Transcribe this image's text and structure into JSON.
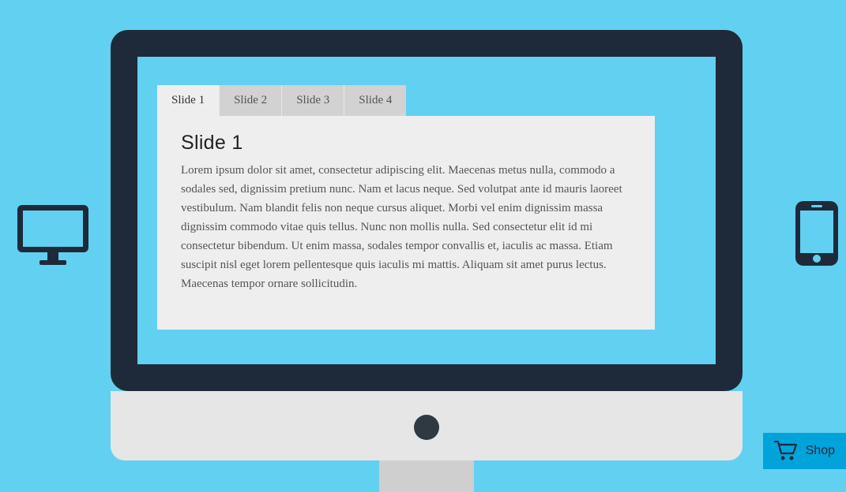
{
  "tabs": [
    {
      "label": "Slide 1",
      "active": true
    },
    {
      "label": "Slide 2",
      "active": false
    },
    {
      "label": "Slide 3",
      "active": false
    },
    {
      "label": "Slide 4",
      "active": false
    }
  ],
  "panel": {
    "title": "Slide 1",
    "body": "Lorem ipsum dolor sit amet, consectetur adipiscing elit. Maecenas metus nulla, commodo a sodales sed, dignissim pretium nunc. Nam et lacus neque. Sed volutpat ante id mauris laoreet vestibulum. Nam blandit felis non neque cursus aliquet. Morbi vel enim dignissim massa dignissim commodo vitae quis tellus. Nunc non mollis nulla. Sed consectetur elit id mi consectetur bibendum. Ut enim massa, sodales tempor convallis et, iaculis ac massa. Etiam suscipit nisl eget lorem pellentesque quis iaculis mi mattis. Aliquam sit amet purus lectus. Maecenas tempor ornare sollicitudin."
  },
  "cart": {
    "label": "Shop"
  }
}
